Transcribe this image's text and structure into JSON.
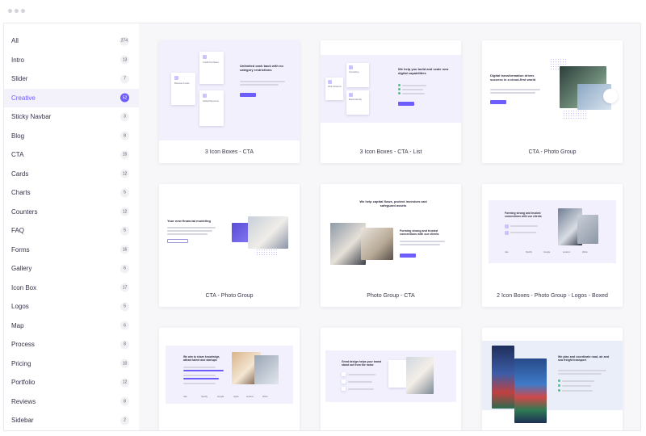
{
  "window": {
    "controls": [
      "window-dot",
      "window-dot",
      "window-dot"
    ]
  },
  "sidebar": {
    "items": [
      {
        "label": "All",
        "count": "274"
      },
      {
        "label": "Intro",
        "count": "13"
      },
      {
        "label": "Slider",
        "count": "7"
      },
      {
        "label": "Creative",
        "count": "52",
        "active": true
      },
      {
        "label": "Sticky Navbar",
        "count": "3"
      },
      {
        "label": "Blog",
        "count": "8"
      },
      {
        "label": "CTA",
        "count": "15"
      },
      {
        "label": "Cards",
        "count": "12"
      },
      {
        "label": "Charts",
        "count": "5"
      },
      {
        "label": "Counters",
        "count": "12"
      },
      {
        "label": "FAQ",
        "count": "5"
      },
      {
        "label": "Forms",
        "count": "16"
      },
      {
        "label": "Gallery",
        "count": "6"
      },
      {
        "label": "Icon Box",
        "count": "17"
      },
      {
        "label": "Logos",
        "count": "5"
      },
      {
        "label": "Map",
        "count": "6"
      },
      {
        "label": "Process",
        "count": "8"
      },
      {
        "label": "Pricing",
        "count": "10"
      },
      {
        "label": "Portfolio",
        "count": "12"
      },
      {
        "label": "Reviews",
        "count": "8"
      },
      {
        "label": "Sidebar",
        "count": "2"
      }
    ]
  },
  "cards": [
    {
      "title": "3 Icon Boxes - CTA",
      "preview": {
        "heading": "Unlimited cash back with no category restrictions",
        "box_a": "Business Funds",
        "box_b": "Credit Purchases",
        "box_c": "Global Payments",
        "button": "Learn more"
      }
    },
    {
      "title": "3 Icon Boxes - CTA - List",
      "preview": {
        "heading": "We help you build and scale new digital capabilities",
        "box_a": "Consulting",
        "box_b": "Web Solutions",
        "box_c": "Brand Identity"
      }
    },
    {
      "title": "CTA - Photo Group",
      "preview": {
        "heading": "Digital transformation drives success in a cloud-first world"
      }
    },
    {
      "title": "CTA - Photo Group",
      "preview": {
        "heading": "Your new financial modeling"
      }
    },
    {
      "title": "Photo Group - CTA",
      "preview": {
        "heading": "We help capital flows, protect investors and safeguard assets",
        "sub": "Forming strong and trusted connections with our clients"
      }
    },
    {
      "title": "2 Icon Boxes - Photo Group - Logos - Boxed",
      "preview": {
        "heading": "Forming strong and trusted connections with our clients",
        "logos": [
          "nike",
          "Spotify",
          "Google",
          "amazon",
          "Zillow"
        ]
      }
    },
    {
      "title": "",
      "preview": {
        "heading": "We aim to share knowledge, attract talent and startups",
        "logos": [
          "nike",
          "Spotify",
          "Google",
          "Apple",
          "amazon",
          "Zillow"
        ]
      }
    },
    {
      "title": "",
      "preview": {
        "heading": "Great design helps your brand stand out from the noise"
      }
    },
    {
      "title": "",
      "preview": {
        "heading": "We plan and coordinate road, air and sea freight transport"
      }
    }
  ],
  "colors": {
    "accent": "#6d5dfc",
    "preview_tint": "#f1f0fc",
    "card_bg": "#ffffff",
    "main_bg": "#f7f7f9"
  }
}
